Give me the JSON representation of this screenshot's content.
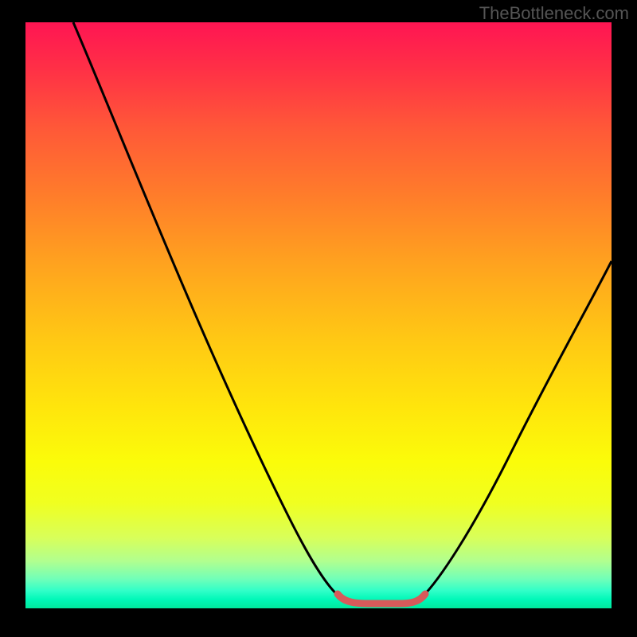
{
  "watermark": "TheBottleneck.com",
  "chart_data": {
    "type": "line",
    "title": "",
    "xlabel": "",
    "ylabel": "",
    "xlim": [
      0,
      100
    ],
    "ylim": [
      0,
      100
    ],
    "x": [
      0,
      5,
      10,
      15,
      20,
      25,
      30,
      35,
      40,
      45,
      50,
      52,
      55,
      58,
      60,
      62,
      65,
      70,
      75,
      80,
      85,
      90,
      95,
      100
    ],
    "values": [
      100,
      92,
      83,
      74,
      65,
      56,
      47,
      38,
      29,
      20,
      10,
      5,
      1,
      0,
      0,
      0,
      1,
      8,
      18,
      28,
      38,
      48,
      55,
      60
    ],
    "optimal_range_x": [
      52,
      65
    ],
    "gradient_stops": [
      {
        "pos": 0,
        "color": "#ff1553"
      },
      {
        "pos": 30,
        "color": "#ff7e2a"
      },
      {
        "pos": 66,
        "color": "#ffe60c"
      },
      {
        "pos": 100,
        "color": "#00e89c"
      }
    ]
  }
}
